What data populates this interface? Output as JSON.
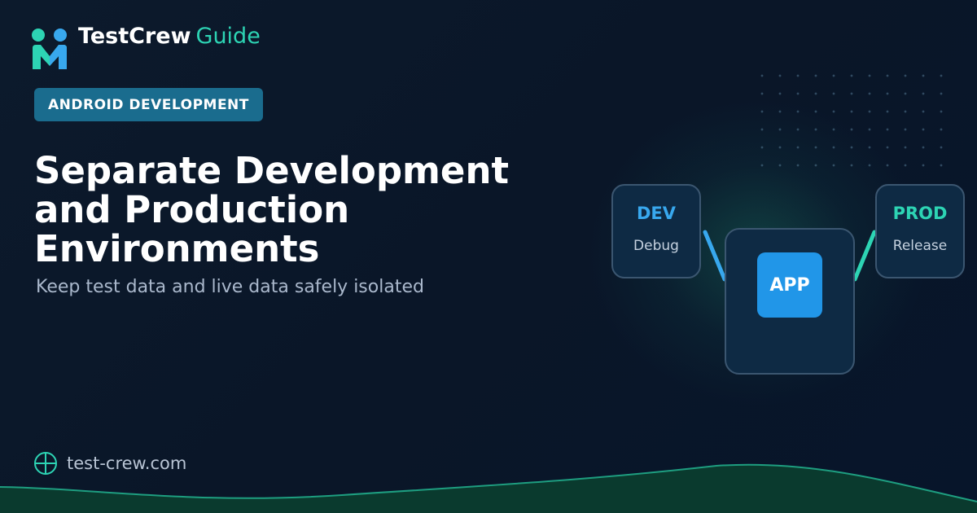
{
  "brand": {
    "name": "TestCrew",
    "suffix": "Guide",
    "logo_icon": "two-person-m-logo-icon",
    "accent_color": "#2dd4b4"
  },
  "category": {
    "label": "ANDROID DEVELOPMENT",
    "color": "#1a6c8e"
  },
  "headline": {
    "lines": [
      "Separate Development",
      "and Production",
      "Environments"
    ],
    "subtitle": "Keep test data and live data safely isolated"
  },
  "diagram": {
    "dev": {
      "label": "DEV",
      "sub": "Debug",
      "color": "#38a8ee"
    },
    "prod": {
      "label": "PROD",
      "sub": "Release",
      "color": "#2dd4b4"
    },
    "app": {
      "label": "APP",
      "color": "#2196e8"
    }
  },
  "footer": {
    "site": "test-crew.com",
    "icon": "globe-icon"
  }
}
